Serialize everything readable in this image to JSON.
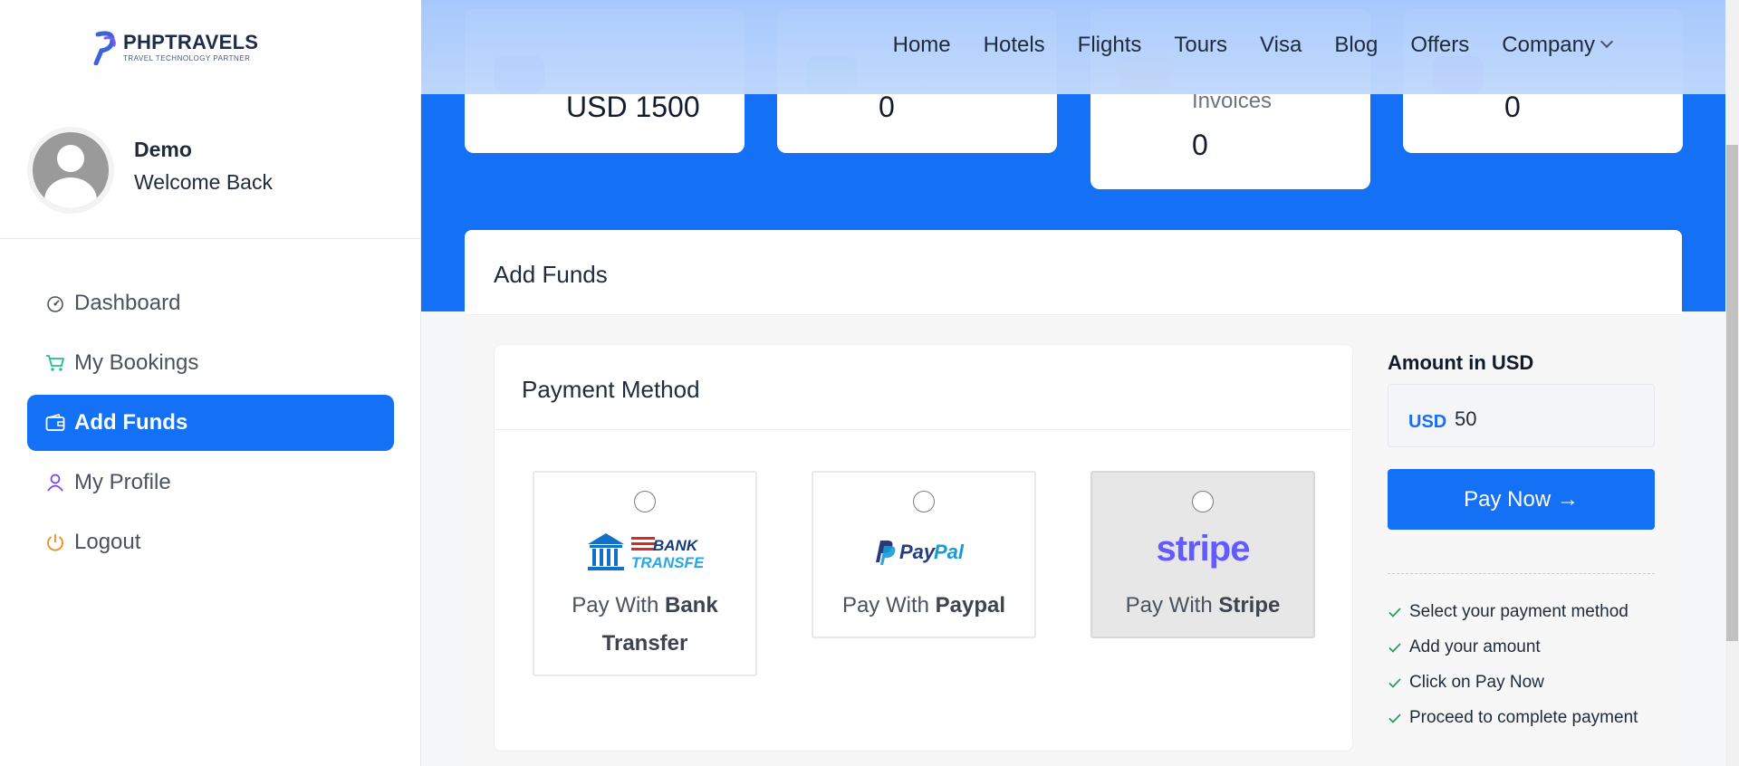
{
  "header": {
    "logo_name": "PHPTRAVELS",
    "logo_tagline": "TRAVEL TECHNOLOGY PARTNER",
    "nav": [
      "Home",
      "Hotels",
      "Flights",
      "Tours",
      "Visa",
      "Blog",
      "Offers",
      "Company"
    ]
  },
  "sidebar": {
    "user_name": "Demo",
    "welcome": "Welcome Back",
    "items": [
      {
        "label": "Dashboard",
        "icon": "gauge-icon",
        "active": false
      },
      {
        "label": "My Bookings",
        "icon": "cart-icon",
        "active": false
      },
      {
        "label": "Add Funds",
        "icon": "wallet-icon",
        "active": true
      },
      {
        "label": "My Profile",
        "icon": "user-icon",
        "active": false
      },
      {
        "label": "Logout",
        "icon": "power-icon",
        "active": false
      }
    ]
  },
  "stats": [
    {
      "label": "",
      "value": "USD 1500",
      "chip_color": "#1470f5"
    },
    {
      "label": "",
      "value": "0",
      "chip_color": "#22d3a0"
    },
    {
      "label": "Invoices",
      "value": "0",
      "chip_color": "#f5b342"
    },
    {
      "label": "",
      "value": "0",
      "chip_color": "#d41ad6"
    }
  ],
  "add_funds": {
    "title": "Add Funds",
    "payment_method_title": "Payment Method",
    "options": [
      {
        "prefix": "Pay With",
        "name": "Bank Transfer",
        "logo_text": "BANK TRANSFER",
        "selected": false
      },
      {
        "prefix": "Pay With",
        "name": "Paypal",
        "logo_text": "PayPal",
        "selected": false
      },
      {
        "prefix": "Pay With",
        "name": "Stripe",
        "logo_text": "stripe",
        "selected": false
      }
    ],
    "amount_label": "Amount in USD",
    "currency": "USD",
    "amount_value": "50",
    "pay_button": "Pay Now →",
    "steps": [
      "Select your payment method",
      "Add your amount",
      "Click on Pay Now",
      "Proceed to complete payment"
    ]
  },
  "colors": {
    "primary": "#1470f5",
    "stripe_purple": "#635bff",
    "paypal_dark": "#253b80",
    "paypal_light": "#179bd7",
    "check_green": "#2e9b5e"
  }
}
